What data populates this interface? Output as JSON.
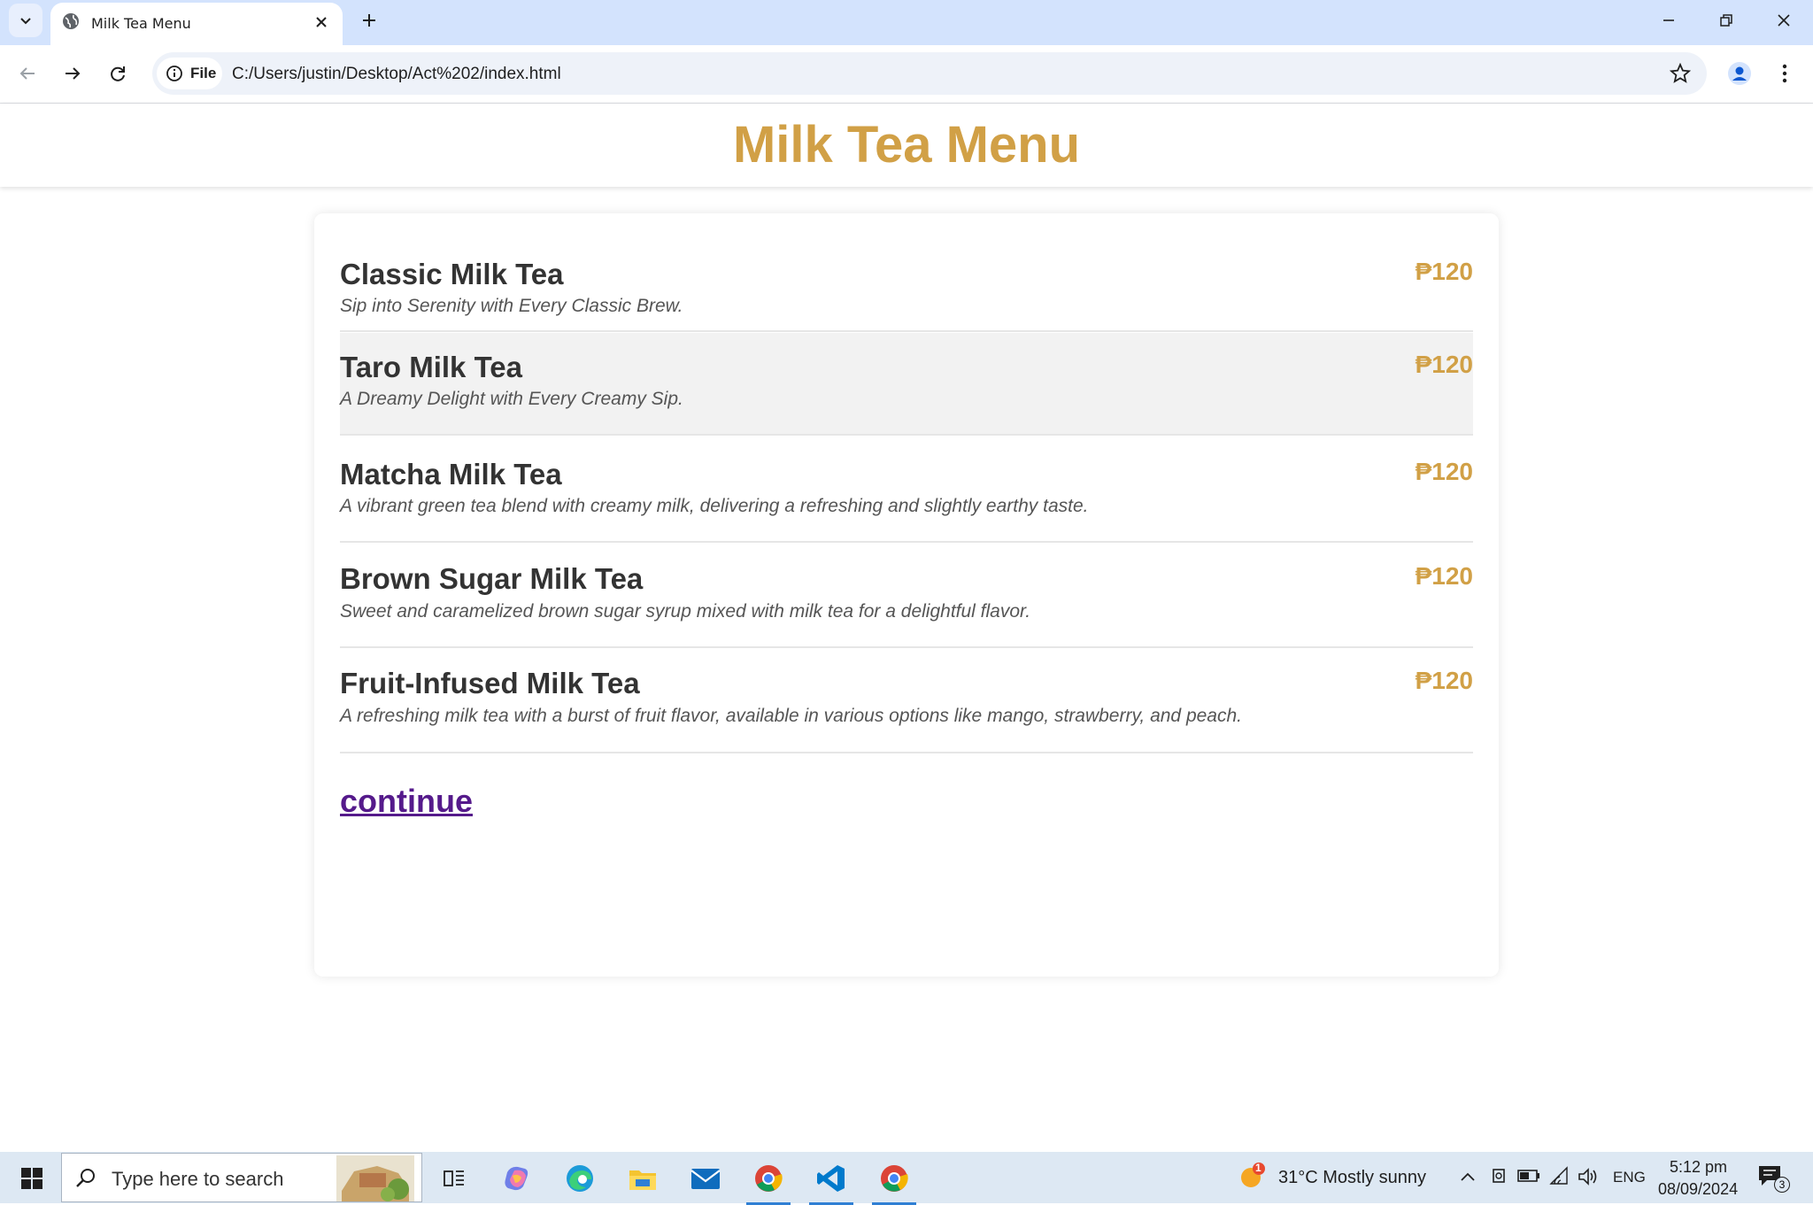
{
  "browser": {
    "tab_title": "Milk Tea Menu",
    "site_chip_label": "File",
    "url": "C:/Users/justin/Desktop/Act%202/index.html"
  },
  "page": {
    "title": "Milk Tea Menu",
    "items": [
      {
        "name": "Classic Milk Tea",
        "description": "Sip into Serenity with Every Classic Brew.",
        "price": "₱120"
      },
      {
        "name": "Taro Milk Tea",
        "description": "A Dreamy Delight with Every Creamy Sip.",
        "price": "₱120"
      },
      {
        "name": "Matcha Milk Tea",
        "description": "A vibrant green tea blend with creamy milk, delivering a refreshing and slightly earthy taste.",
        "price": "₱120"
      },
      {
        "name": "Brown Sugar Milk Tea",
        "description": "Sweet and caramelized brown sugar syrup mixed with milk tea for a delightful flavor.",
        "price": "₱120"
      },
      {
        "name": "Fruit-Infused Milk Tea",
        "description": "A refreshing milk tea with a burst of fruit flavor, available in various options like mango, strawberry, and peach.",
        "price": "₱120"
      }
    ],
    "continue_label": "continue"
  },
  "taskbar": {
    "search_placeholder": "Type here to search",
    "weather": "31°C  Mostly sunny",
    "weather_badge": "1",
    "language": "ENG",
    "time": "5:12 pm",
    "date": "08/09/2024",
    "notification_count": "3"
  },
  "colors": {
    "accent_gold": "#d1a046",
    "link_visited": "#551a8b",
    "tabstrip_bg": "#d3e3fd"
  }
}
